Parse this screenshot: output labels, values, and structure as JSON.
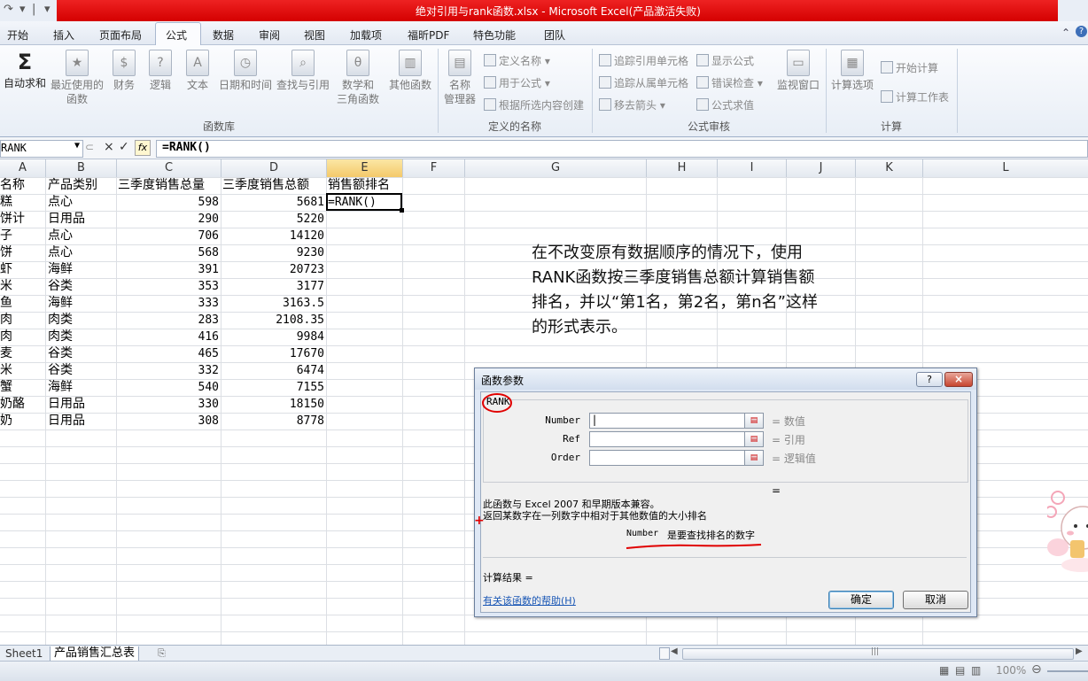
{
  "window": {
    "title": "绝对引用与rank函数.xlsx - Microsoft Excel(产品激活失败)"
  },
  "ribbon_tabs": [
    "开始",
    "插入",
    "页面布局",
    "公式",
    "数据",
    "审阅",
    "视图",
    "加载项",
    "福昕PDF",
    "特色功能",
    "团队"
  ],
  "ribbon": {
    "function_library": {
      "label": "函数库",
      "autosum": "自动求和",
      "recent": "最近使用的\n函数",
      "financial": "财务",
      "logical": "逻辑",
      "text": "文本",
      "datetime": "日期和时间",
      "lookup": "查找与引用",
      "math": "数学和\n三角函数",
      "more": "其他函数"
    },
    "defined_names": {
      "label": "定义的名称",
      "name_manager": "名称\n管理器",
      "define": "定义名称",
      "use_in_formula": "用于公式",
      "create": "根据所选内容创建"
    },
    "audit": {
      "label": "公式审核",
      "trace_precedents": "追踪引用单元格",
      "trace_dependents": "追踪从属单元格",
      "remove_arrows": "移去箭头",
      "show_formulas": "显示公式",
      "error_check": "错误检查",
      "evaluate": "公式求值",
      "watch": "监视窗口"
    },
    "calculation": {
      "label": "计算",
      "options": "计算选项",
      "calc_now": "开始计算",
      "calc_sheet": "计算工作表"
    }
  },
  "formula_bar": {
    "name_box": "RANK",
    "cancel": "×",
    "enter": "✓",
    "fx": "fx",
    "formula": "=RANK()"
  },
  "columns": [
    "A",
    "B",
    "C",
    "D",
    "E",
    "F",
    "G",
    "H",
    "I",
    "J",
    "K",
    "L"
  ],
  "sheet": {
    "headers": [
      "名称",
      "产品类别",
      "三季度销售总量",
      "三季度销售总额",
      "销售额排名"
    ],
    "rows": [
      {
        "a": "糕",
        "b": "点心",
        "c": "598",
        "d": "5681",
        "e": "=RANK()"
      },
      {
        "a": "饼计",
        "b": "日用品",
        "c": "290",
        "d": "5220",
        "e": ""
      },
      {
        "a": "子",
        "b": "点心",
        "c": "706",
        "d": "14120",
        "e": ""
      },
      {
        "a": "饼",
        "b": "点心",
        "c": "568",
        "d": "9230",
        "e": ""
      },
      {
        "a": "虾",
        "b": "海鲜",
        "c": "391",
        "d": "20723",
        "e": ""
      },
      {
        "a": "米",
        "b": "谷类",
        "c": "353",
        "d": "3177",
        "e": ""
      },
      {
        "a": "鱼",
        "b": "海鲜",
        "c": "333",
        "d": "3163.5",
        "e": ""
      },
      {
        "a": "肉",
        "b": "肉类",
        "c": "283",
        "d": "2108.35",
        "e": ""
      },
      {
        "a": "肉",
        "b": "肉类",
        "c": "416",
        "d": "9984",
        "e": ""
      },
      {
        "a": "麦",
        "b": "谷类",
        "c": "465",
        "d": "17670",
        "e": ""
      },
      {
        "a": "米",
        "b": "谷类",
        "c": "332",
        "d": "6474",
        "e": ""
      },
      {
        "a": "蟹",
        "b": "海鲜",
        "c": "540",
        "d": "7155",
        "e": ""
      },
      {
        "a": "奶酪",
        "b": "日用品",
        "c": "330",
        "d": "18150",
        "e": ""
      },
      {
        "a": "奶",
        "b": "日用品",
        "c": "308",
        "d": "8778",
        "e": ""
      }
    ]
  },
  "note": "在不改变原有数据顺序的情况下，使用RANK函数按三季度销售总额计算销售额排名，并以“第1名，第2名，第n名”这样的形式表示。",
  "dialog": {
    "title": "函数参数",
    "help_btn": "?",
    "close_btn": "×",
    "function_name": "RANK",
    "args": [
      {
        "label": "Number",
        "hint": "= 数值"
      },
      {
        "label": "Ref",
        "hint": "= 引用"
      },
      {
        "label": "Order",
        "hint": "= 逻辑值"
      }
    ],
    "result_eq": "=",
    "compat": "此函数与 Excel 2007 和早期版本兼容。",
    "description": "返回某数字在一列数字中相对于其他数值的大小排名",
    "arg_desc_name": "Number",
    "arg_desc": "是要查找排名的数字",
    "calc_result": "计算结果 =",
    "help_link": "有关该函数的帮助(H)",
    "ok": "确定",
    "cancel": "取消"
  },
  "sheet_tabs": [
    "Sheet1",
    "产品销售汇总表"
  ],
  "status": {
    "zoom": "100%"
  },
  "colors": {
    "title_bar": "#d40000",
    "annotation": "#e00000",
    "selected_header": "#f4c96a"
  }
}
